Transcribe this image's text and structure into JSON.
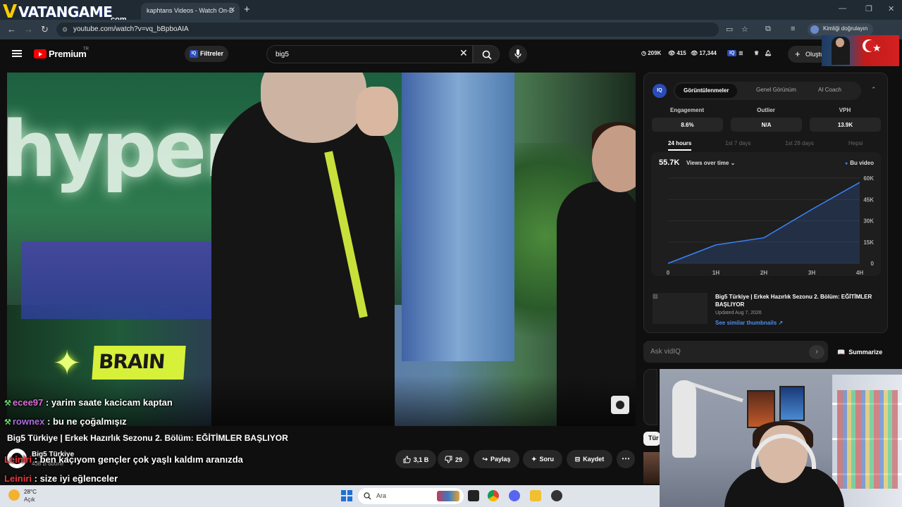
{
  "overlay": {
    "logo_text": "VATANGAME",
    "logo_sub": ".com"
  },
  "browser": {
    "tab_title": "kaphtans Videos - Watch On-D",
    "url": "youtube.com/watch?v=vq_bBpboAIA",
    "profile_label": "Kimliği doğrulayın"
  },
  "youtube": {
    "brand": "Premium",
    "region": "TR",
    "filters_label": "Filtreler",
    "search_value": "big5",
    "stats": {
      "views": "209K",
      "likes": "415",
      "watching": "17,344"
    },
    "create_label": "Oluştur"
  },
  "chat": [
    {
      "user": "ecee97",
      "message": " : yarim saate kacicam kaptan"
    },
    {
      "user": "rownex",
      "message": " : bu ne çoğalmışız"
    },
    {
      "user": "Leiniri",
      "message": " : ben kaçıyom gençler çok yaşlı kaldım aranızda"
    },
    {
      "user": "Leiniri",
      "message": " : size iyi eğlenceler"
    }
  ],
  "video": {
    "title": "Big5 Türkiye | Erkek Hazırlık Sezonu 2. Bölüm: EĞİTİMLER BAŞLIYOR",
    "channel": "Big5 Türkiye",
    "subscribers": "438 B abone",
    "likes": "3,1 B",
    "dislikes": "29",
    "share_label": "Paylaş",
    "ask_label": "Soru",
    "save_label": "Kaydet"
  },
  "vidiq": {
    "logo": "IQ",
    "tabs": [
      "Görüntülenmeler",
      "Genel Görünüm",
      "AI Coach"
    ],
    "metrics": [
      {
        "label": "Engagement",
        "value": "8.6%"
      },
      {
        "label": "Outlier",
        "value": "N/A"
      },
      {
        "label": "VPH",
        "value": "13.9K"
      }
    ],
    "ranges": [
      "24 hours",
      "1st 7 days",
      "1st 28 days",
      "Hepsi"
    ],
    "chart_value": "55.7K",
    "chart_metric": "Views over time",
    "legend": "Bu video",
    "video_title": "Big5 Türkiye | Erkek Hazırlık Sezonu 2. Bölüm: EĞİTİMLER BAŞLIYOR",
    "updated": "Updated Aug 7, 2026",
    "similar_link": "See similar thumbnails ↗",
    "ask_placeholder": "Ask vidIQ",
    "summarize_label": "Summarize"
  },
  "chart_data": {
    "type": "line",
    "x": [
      "0",
      "1H",
      "2H",
      "3H",
      "4H"
    ],
    "series": [
      {
        "name": "Bu video",
        "values": [
          0,
          13000,
          18000,
          38000,
          57000
        ]
      }
    ],
    "y_ticks": [
      "0",
      "15K",
      "30K",
      "45K",
      "60K"
    ],
    "ylim": [
      0,
      60000
    ],
    "grid": true
  },
  "side": {
    "chip": "Tür"
  },
  "taskbar": {
    "temp": "28°C",
    "condition": "Açık",
    "search_placeholder": "Ara"
  },
  "colors": {
    "accent": "#3b82f6",
    "yt_red": "#ff0000",
    "link": "#4b8ff0"
  }
}
